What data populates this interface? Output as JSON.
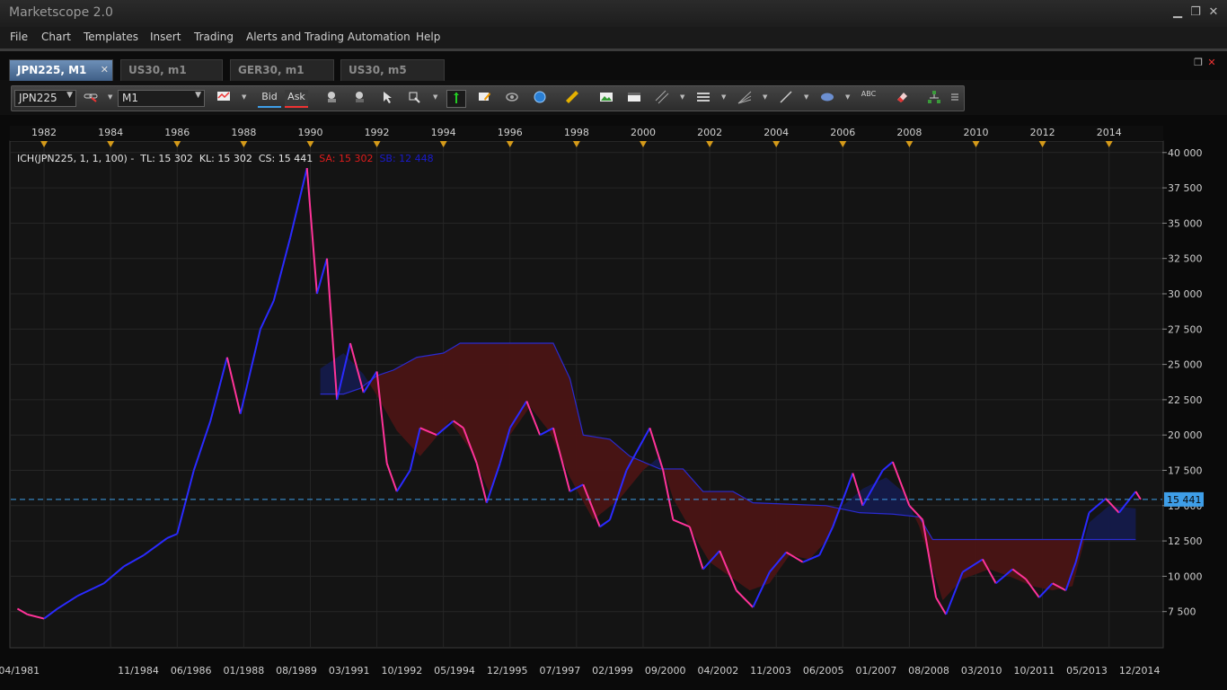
{
  "window": {
    "title": "Marketscope 2.0",
    "minimize": "▁",
    "restore": "❐",
    "close": "✕"
  },
  "menu": [
    "File",
    "Chart",
    "Templates",
    "Insert",
    "Trading",
    "Alerts and Trading Automation",
    "Help"
  ],
  "tabs": [
    {
      "label": "JPN225, M1",
      "active": true,
      "close": "✕"
    },
    {
      "label": "US30, m1",
      "active": false
    },
    {
      "label": "GER30, m1",
      "active": false
    },
    {
      "label": "US30, m5",
      "active": false
    }
  ],
  "tab_controls": {
    "restore": "❐",
    "close": "✕"
  },
  "toolbar": {
    "symbol": "JPN225",
    "timeframe": "M1",
    "bid_label": "Bid",
    "ask_label": "Ask",
    "abc_label": "ABC",
    "icons": [
      "link-icon",
      "candle-type-icon",
      "zoom-in-icon",
      "zoom-out-icon",
      "pointer-icon",
      "crosshair-icon",
      "period-separator-icon",
      "marker-icon",
      "eye-icon",
      "globe-icon",
      "ruler-icon",
      "image-icon",
      "window-icon",
      "channel-icon",
      "horizontal-lines-icon",
      "fan-icon",
      "trendline-icon",
      "ellipse-icon",
      "text-icon",
      "eraser-icon",
      "tree-icon",
      "menu-icon"
    ]
  },
  "indicator": {
    "label": "ICH(JPN225, 1, 1, 100) -  TL: 15 302  KL: 15 302  CS: 15 441",
    "sa": "SA: 15 302",
    "sb": "SB: 12 448"
  },
  "price_marker": "15 441",
  "colors": {
    "accent": "#3e9ee8",
    "bull": "#1a1aff",
    "bear": "#ff3399",
    "cloud_red": "#4a1414",
    "cloud_blue": "#141a4a"
  },
  "chart_data": {
    "type": "line",
    "title": "",
    "symbol": "JPN225",
    "timeframe": "M1",
    "x_top_labels": [
      "1982",
      "1984",
      "1986",
      "1988",
      "1990",
      "1992",
      "1994",
      "1996",
      "1998",
      "2000",
      "2002",
      "2004",
      "2006",
      "2008",
      "2010",
      "2012",
      "2014"
    ],
    "x_bottom_labels": [
      "04/1981",
      "11/1984",
      "06/1986",
      "01/1988",
      "08/1989",
      "03/1991",
      "10/1992",
      "05/1994",
      "12/1995",
      "07/1997",
      "02/1999",
      "09/2000",
      "04/2002",
      "11/2003",
      "06/2005",
      "01/2007",
      "08/2008",
      "03/2010",
      "10/2011",
      "05/2013",
      "12/2014"
    ],
    "y_tick_labels": [
      "40 000",
      "37 500",
      "35 000",
      "32 500",
      "30 000",
      "27 500",
      "25 000",
      "22 500",
      "20 000",
      "17 500",
      "15 000",
      "12 500",
      "10 000",
      "7 500"
    ],
    "ylim": [
      5000,
      40750
    ],
    "xlim": [
      1981.0,
      2015.6
    ],
    "grid": true,
    "price_line": [
      [
        1981.2,
        7700
      ],
      [
        1981.5,
        7300
      ],
      [
        1982.0,
        7000
      ],
      [
        1982.4,
        7700
      ],
      [
        1983.0,
        8600
      ],
      [
        1983.8,
        9500
      ],
      [
        1984.4,
        10700
      ],
      [
        1985.0,
        11500
      ],
      [
        1985.7,
        12700
      ],
      [
        1986.0,
        13000
      ],
      [
        1986.5,
        17500
      ],
      [
        1987.0,
        21000
      ],
      [
        1987.5,
        25500
      ],
      [
        1987.9,
        21500
      ],
      [
        1988.5,
        27500
      ],
      [
        1988.9,
        29500
      ],
      [
        1989.4,
        34000
      ],
      [
        1989.9,
        38900
      ],
      [
        1990.2,
        30000
      ],
      [
        1990.5,
        32500
      ],
      [
        1990.8,
        22500
      ],
      [
        1991.2,
        26500
      ],
      [
        1991.6,
        23000
      ],
      [
        1992.0,
        24500
      ],
      [
        1992.3,
        18000
      ],
      [
        1992.6,
        16000
      ],
      [
        1993.0,
        17500
      ],
      [
        1993.3,
        20500
      ],
      [
        1993.8,
        20000
      ],
      [
        1994.3,
        21000
      ],
      [
        1994.6,
        20500
      ],
      [
        1995.0,
        18000
      ],
      [
        1995.3,
        15200
      ],
      [
        1995.7,
        18000
      ],
      [
        1996.0,
        20500
      ],
      [
        1996.5,
        22400
      ],
      [
        1996.9,
        20000
      ],
      [
        1997.3,
        20500
      ],
      [
        1997.8,
        16000
      ],
      [
        1998.2,
        16500
      ],
      [
        1998.7,
        13500
      ],
      [
        1999.0,
        14000
      ],
      [
        1999.5,
        17500
      ],
      [
        2000.2,
        20500
      ],
      [
        2000.6,
        17500
      ],
      [
        2000.9,
        14000
      ],
      [
        2001.4,
        13500
      ],
      [
        2001.8,
        10500
      ],
      [
        2002.3,
        11800
      ],
      [
        2002.8,
        9000
      ],
      [
        2003.3,
        7800
      ],
      [
        2003.8,
        10300
      ],
      [
        2004.3,
        11700
      ],
      [
        2004.8,
        11000
      ],
      [
        2005.3,
        11500
      ],
      [
        2005.7,
        13500
      ],
      [
        2006.3,
        17300
      ],
      [
        2006.6,
        15000
      ],
      [
        2007.2,
        17500
      ],
      [
        2007.5,
        18100
      ],
      [
        2008.0,
        15000
      ],
      [
        2008.4,
        14000
      ],
      [
        2008.8,
        8500
      ],
      [
        2009.1,
        7300
      ],
      [
        2009.6,
        10300
      ],
      [
        2010.2,
        11200
      ],
      [
        2010.6,
        9500
      ],
      [
        2011.1,
        10500
      ],
      [
        2011.5,
        9800
      ],
      [
        2011.9,
        8500
      ],
      [
        2012.3,
        9500
      ],
      [
        2012.7,
        9000
      ],
      [
        2013.0,
        11000
      ],
      [
        2013.4,
        14500
      ],
      [
        2013.9,
        15500
      ],
      [
        2014.3,
        14500
      ],
      [
        2014.8,
        16000
      ],
      [
        2014.95,
        15441
      ]
    ],
    "senkou_a": [
      [
        1990.3,
        22900
      ],
      [
        1991.0,
        22900
      ],
      [
        1991.5,
        23300
      ],
      [
        1992.0,
        24200
      ],
      [
        1992.5,
        24600
      ],
      [
        1993.2,
        25500
      ],
      [
        1994.0,
        25800
      ],
      [
        1994.5,
        26500
      ],
      [
        1997.3,
        26500
      ],
      [
        1997.8,
        24000
      ],
      [
        1998.2,
        20000
      ],
      [
        1999.0,
        19700
      ],
      [
        1999.6,
        18500
      ],
      [
        2000.5,
        17600
      ],
      [
        2001.2,
        17600
      ],
      [
        2001.8,
        16000
      ],
      [
        2002.7,
        16000
      ],
      [
        2003.3,
        15200
      ],
      [
        2005.5,
        15000
      ],
      [
        2006.5,
        14500
      ],
      [
        2007.5,
        14400
      ],
      [
        2008.3,
        14200
      ],
      [
        2008.7,
        12600
      ],
      [
        2013.4,
        12600
      ],
      [
        2014.8,
        12600
      ]
    ],
    "senkou_b": [
      [
        1990.3,
        24700
      ],
      [
        1991.0,
        25800
      ],
      [
        1991.6,
        24300
      ],
      [
        1992.0,
        22800
      ],
      [
        1992.6,
        20300
      ],
      [
        1993.3,
        18500
      ],
      [
        1994.2,
        21000
      ],
      [
        1994.8,
        19000
      ],
      [
        1995.4,
        15800
      ],
      [
        1996.0,
        20000
      ],
      [
        1996.6,
        22000
      ],
      [
        1997.2,
        20200
      ],
      [
        1997.8,
        17000
      ],
      [
        1998.5,
        14000
      ],
      [
        1999.3,
        15500
      ],
      [
        2000.0,
        17500
      ],
      [
        2000.5,
        18500
      ],
      [
        2000.9,
        15500
      ],
      [
        2001.5,
        13000
      ],
      [
        2002.0,
        11000
      ],
      [
        2002.6,
        10000
      ],
      [
        2003.2,
        9000
      ],
      [
        2003.8,
        9500
      ],
      [
        2004.4,
        11500
      ],
      [
        2005.0,
        11200
      ],
      [
        2005.5,
        12500
      ],
      [
        2006.0,
        15000
      ],
      [
        2006.6,
        16200
      ],
      [
        2007.3,
        17000
      ],
      [
        2007.8,
        16000
      ],
      [
        2008.3,
        13500
      ],
      [
        2009.0,
        8300
      ],
      [
        2009.6,
        9800
      ],
      [
        2010.4,
        10500
      ],
      [
        2011.0,
        10000
      ],
      [
        2011.7,
        9300
      ],
      [
        2012.3,
        9000
      ],
      [
        2012.9,
        9300
      ],
      [
        2013.4,
        13800
      ],
      [
        2014.0,
        15000
      ],
      [
        2014.8,
        14800
      ]
    ],
    "current_price": 15441
  }
}
